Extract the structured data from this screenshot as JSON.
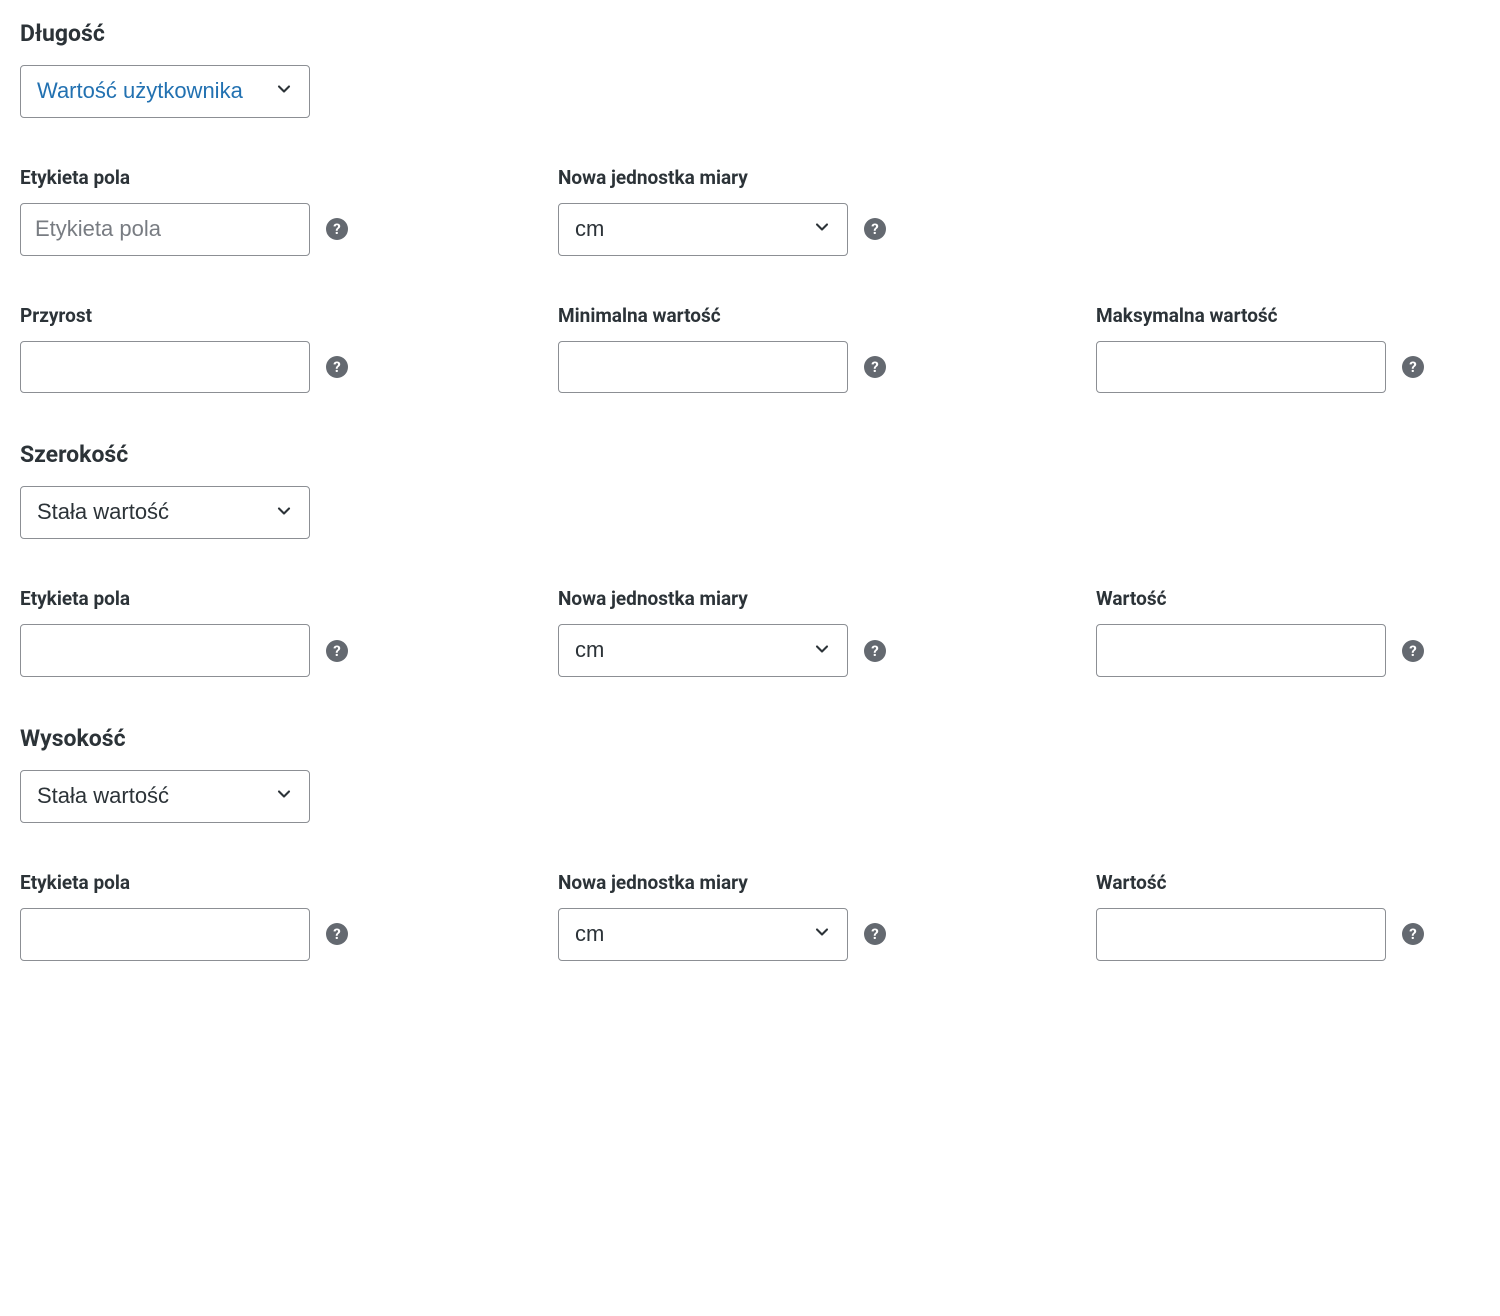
{
  "length": {
    "title": "Długość",
    "mode_selected": "Wartość użytkownika",
    "field_label_label": "Etykieta pola",
    "field_label_placeholder": "Etykieta pola",
    "unit_label": "Nowa jednostka miary",
    "unit_selected": "cm",
    "increment_label": "Przyrost",
    "min_label": "Minimalna wartość",
    "max_label": "Maksymalna wartość"
  },
  "width": {
    "title": "Szerokość",
    "mode_selected": "Stała wartość",
    "field_label_label": "Etykieta pola",
    "unit_label": "Nowa jednostka miary",
    "unit_selected": "cm",
    "value_label": "Wartość"
  },
  "height": {
    "title": "Wysokość",
    "mode_selected": "Stała wartość",
    "field_label_label": "Etykieta pola",
    "unit_label": "Nowa jednostka miary",
    "unit_selected": "cm",
    "value_label": "Wartość"
  }
}
